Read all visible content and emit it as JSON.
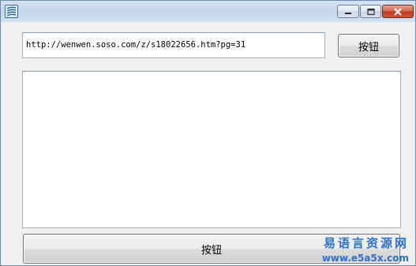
{
  "window": {
    "accent": "#c6d6ea",
    "controls": {
      "minimize_icon": "minimize-icon",
      "maximize_icon": "maximize-icon",
      "close_icon": "close-icon"
    }
  },
  "form": {
    "url_value": "http://wenwen.soso.com/z/s18022656.htm?pg=31",
    "top_button_label": "按钮",
    "bottom_button_label": "按钮",
    "textarea_value": ""
  },
  "watermark": {
    "title": "易语言资源网",
    "url": "www.e5a5x.com",
    "color": "#2d72c9"
  }
}
